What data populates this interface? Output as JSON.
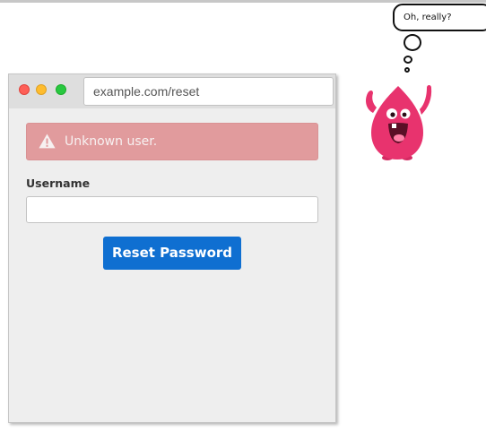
{
  "browser": {
    "url": "example.com/reset"
  },
  "alert": {
    "icon": "warning-icon",
    "message": "Unknown user."
  },
  "form": {
    "username_label": "Username",
    "username_value": "",
    "submit_label": "Reset Password"
  },
  "mascot": {
    "thought": "Oh, really?"
  },
  "colors": {
    "alert_bg": "#e19b9d",
    "button_bg": "#0f6fd1",
    "mascot_body": "#e8336e"
  }
}
